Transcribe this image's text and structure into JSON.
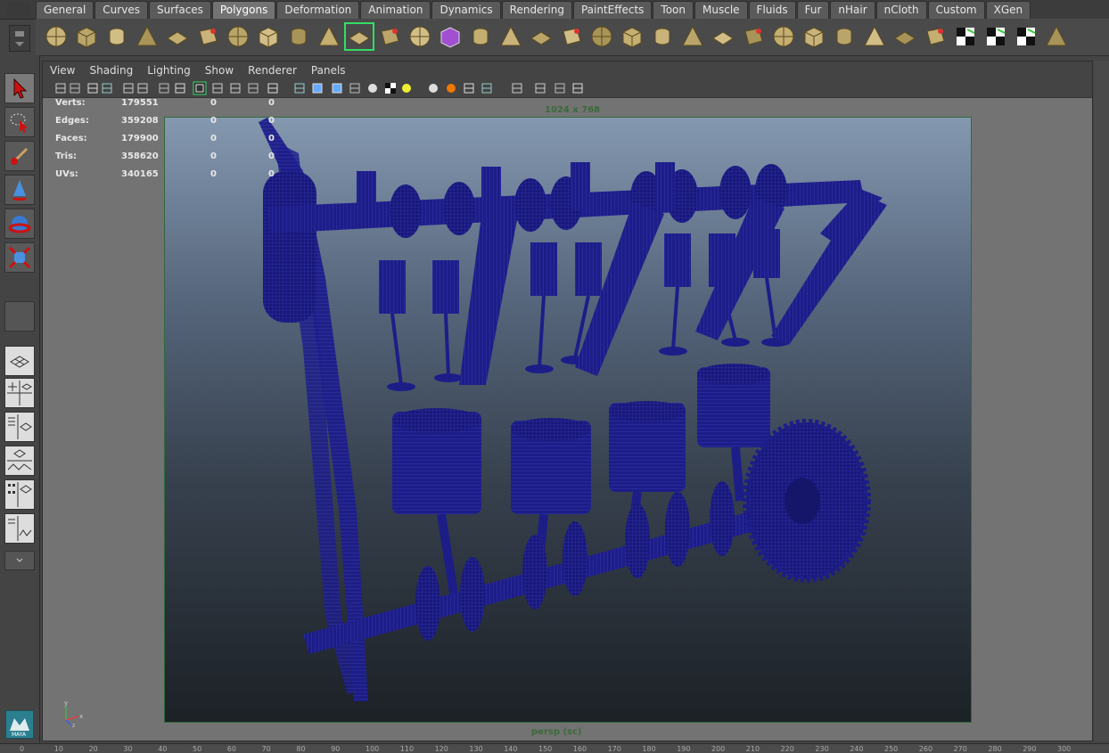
{
  "shelf": {
    "tabs": [
      "General",
      "Curves",
      "Surfaces",
      "Polygons",
      "Deformation",
      "Animation",
      "Dynamics",
      "Rendering",
      "PaintEffects",
      "Toon",
      "Muscle",
      "Fluids",
      "Fur",
      "nHair",
      "nCloth",
      "Custom",
      "XGen"
    ],
    "active_tab": "Polygons",
    "icons": [
      "poly-sphere-icon",
      "poly-cube-icon",
      "poly-cylinder-icon",
      "poly-cone-icon",
      "poly-plane-icon",
      "poly-torus-icon",
      "poly-pyramid-icon",
      "poly-pipe-icon",
      "soccer-ball-icon",
      "combine-icon",
      "separate-icon",
      "extract-icon",
      "booleans-icon",
      "smooth-icon",
      "reduce-icon",
      "mirror-icon",
      "append-polygon-icon",
      "split-polygon-icon",
      "extrude-icon",
      "bevel-icon",
      "bridge-icon",
      "insert-edge-loop-icon",
      "merge-vertices-icon",
      "collapse-icon",
      "duplicate-face-icon",
      "wedge-icon",
      "planar-mapping-icon",
      "cylindrical-mapping-icon",
      "spherical-mapping-icon",
      "automatic-mapping-icon",
      "uv-editor-icon",
      "checker-icon",
      "sculpt-icon",
      "transfer-icon"
    ],
    "selected_icon": "separate-icon"
  },
  "panel": {
    "menu": [
      "View",
      "Shading",
      "Lighting",
      "Show",
      "Renderer",
      "Panels"
    ],
    "resolution_label": "1024 x 768",
    "camera_label": "persp (sc)"
  },
  "hud": {
    "rows": [
      {
        "label": "Verts:",
        "value": "179551",
        "sel": "0",
        "comp": "0"
      },
      {
        "label": "Edges:",
        "value": "359208",
        "sel": "0",
        "comp": "0"
      },
      {
        "label": "Faces:",
        "value": "179900",
        "sel": "0",
        "comp": "0"
      },
      {
        "label": "Tris:",
        "value": "358620",
        "sel": "0",
        "comp": "0"
      },
      {
        "label": "UVs:",
        "value": "340165",
        "sel": "0",
        "comp": "0"
      }
    ]
  },
  "axis_labels": {
    "y": "y",
    "x": "x",
    "z": "z"
  },
  "logo_text": "MAYA",
  "time_ticks": [
    "0",
    "10",
    "20",
    "30",
    "40",
    "50",
    "60",
    "70",
    "80",
    "90",
    "100",
    "110",
    "120",
    "130",
    "140",
    "150",
    "160",
    "170",
    "180",
    "190",
    "200",
    "210",
    "220",
    "230",
    "240",
    "250",
    "260",
    "270",
    "280",
    "290",
    "300"
  ],
  "colors": {
    "wire": "#1a1a80",
    "active_tab": "#737373",
    "selection": "#33dd66",
    "gate_border": "#2f6a3a"
  }
}
